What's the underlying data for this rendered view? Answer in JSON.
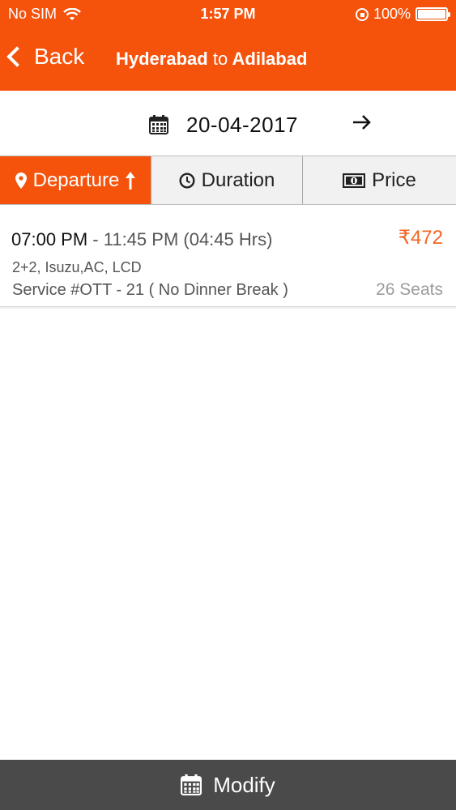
{
  "status_bar": {
    "carrier": "No SIM",
    "time": "1:57 PM",
    "battery": "100%"
  },
  "nav": {
    "back_label": "Back",
    "title_from": "Hyderabad",
    "title_to_word": "to",
    "title_to": "Adilabad"
  },
  "date_bar": {
    "date": "20-04-2017"
  },
  "sort_tabs": [
    {
      "label": "Departure",
      "active": true
    },
    {
      "label": "Duration",
      "active": false
    },
    {
      "label": "Price",
      "active": false
    }
  ],
  "results": [
    {
      "departure": "07:00 PM",
      "separator": " - ",
      "arrival_duration": "11:45 PM (04:45 Hrs)",
      "price": "₹472",
      "features": "2+2, Isuzu,AC, LCD",
      "service": "Service #OTT - 21 ( No Dinner Break )",
      "seats": "26 Seats"
    }
  ],
  "footer": {
    "label": "Modify"
  },
  "colors": {
    "accent": "#f5520c",
    "price": "#f26522",
    "footer_bg": "#4a4a4a"
  }
}
